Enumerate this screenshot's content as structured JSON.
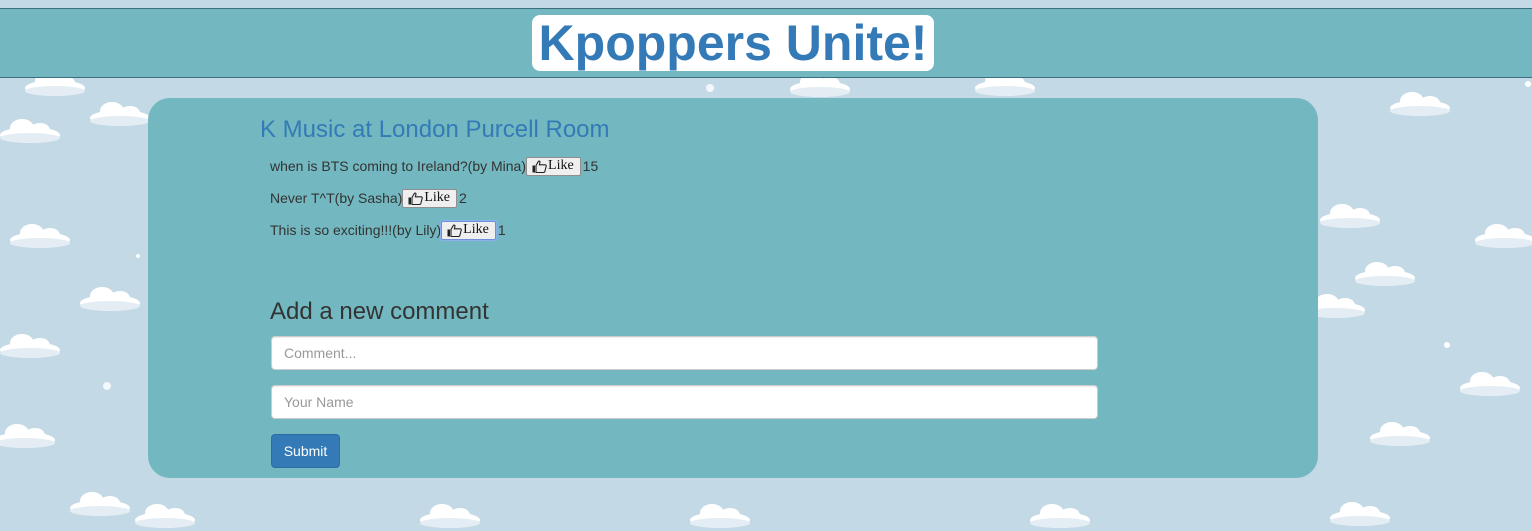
{
  "header": {
    "title": "Kpoppers Unite!"
  },
  "event": {
    "title": "K Music at London Purcell Room"
  },
  "comments": [
    {
      "text": "when is BTS coming to Ireland?",
      "author": "(by Mina)",
      "like_label": "Like",
      "likes": "15"
    },
    {
      "text": "Never T^T",
      "author": "(by Sasha)",
      "like_label": "Like",
      "likes": "2"
    },
    {
      "text": "This is so exciting!!!",
      "author": "(by Lily)",
      "like_label": "Like",
      "likes": "1"
    }
  ],
  "form": {
    "heading": "Add a new comment",
    "comment_placeholder": "Comment...",
    "name_placeholder": "Your Name",
    "submit_label": "Submit"
  },
  "colors": {
    "sky": "#c3d9e6",
    "teal": "#73b8c0",
    "brand_blue": "#337ab7"
  },
  "icons": {
    "like": "thumbs-up-icon"
  }
}
